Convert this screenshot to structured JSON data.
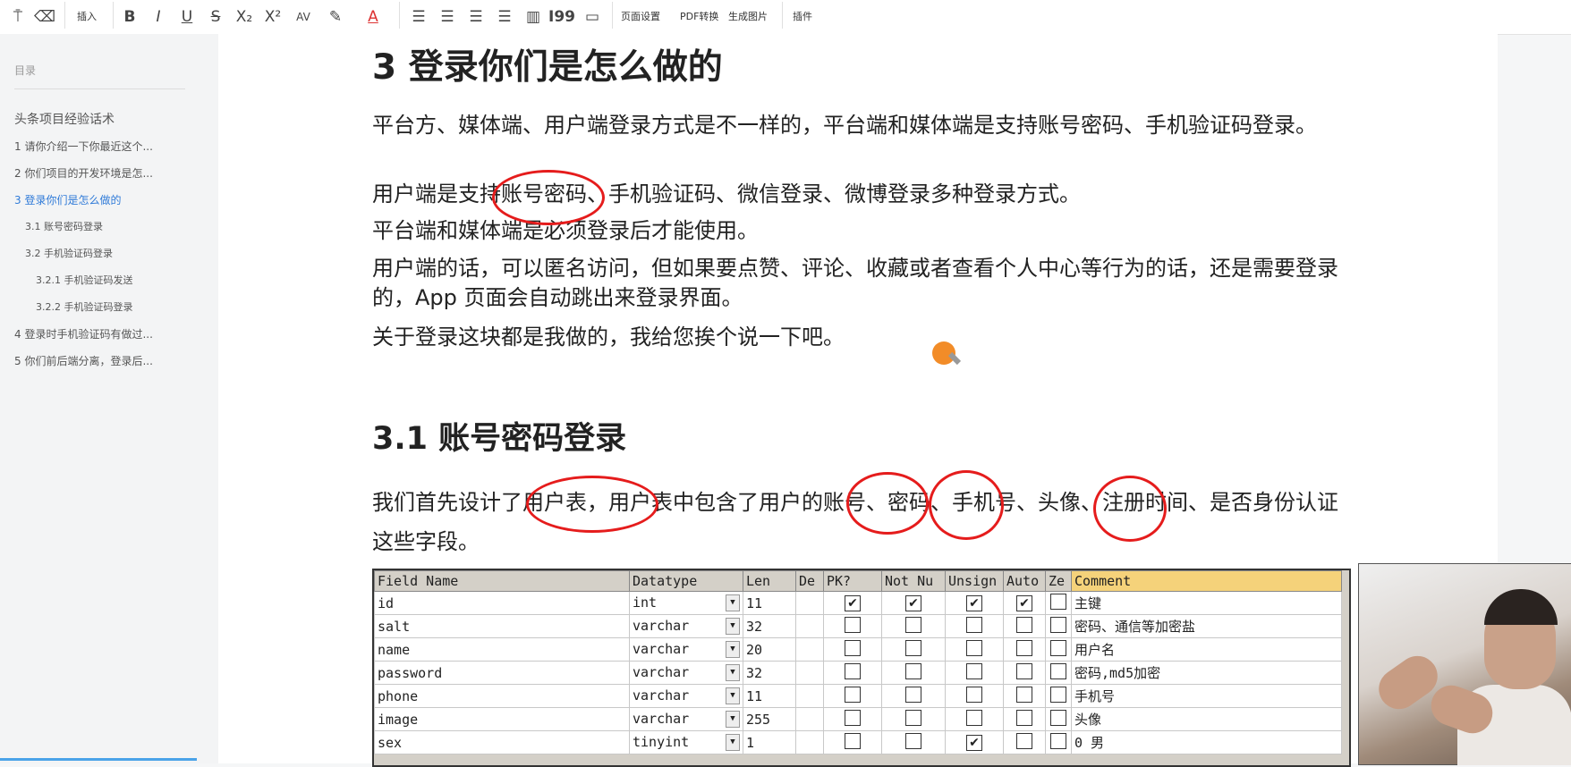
{
  "toolbar": {
    "insert": "插入",
    "page_setup": "页面设置",
    "pdf_convert": "PDF转换",
    "gen_image": "生成图片",
    "plugin": "插件"
  },
  "sidebar": {
    "title": "目录",
    "items": [
      "头条项目经验话术",
      "1 请你介绍一下你最近这个...",
      "2 你们项目的开发环境是怎...",
      "3 登录你们是怎么做的",
      "3.1 账号密码登录",
      "3.2 手机验证码登录",
      "3.2.1 手机验证码发送",
      "3.2.2 手机验证码登录",
      "4 登录时手机验证码有做过...",
      "5 你们前后端分离，登录后..."
    ]
  },
  "doc": {
    "h1": "3 登录你们是怎么做的",
    "p1": "平台方、媒体端、用户端登录方式是不一样的，平台端和媒体端是支持账号密码、手机验证码登录。",
    "p2": "用户端是支持账号密码、手机验证码、微信登录、微博登录多种登录方式。",
    "p3": "平台端和媒体端是必须登录后才能使用。",
    "p4": "用户端的话，可以匿名访问，但如果要点赞、评论、收藏或者查看个人中心等行为的话，还是需要登录的，App 页面会自动跳出来登录界面。",
    "p5": "关于登录这块都是我做的，我给您挨个说一下吧。",
    "h2": "3.1 账号密码登录",
    "p6": "我们首先设计了用户表，用户表中包含了用户的账号、密码、手机号、头像、注册时间、是否身份认证这些字段。"
  },
  "table": {
    "headers": [
      "Field Name",
      "Datatype",
      "Len",
      "De",
      "PK?",
      "Not Nu",
      "Unsign",
      "Auto",
      "Ze",
      "Comment"
    ],
    "rows": [
      {
        "field": "id",
        "type": "int",
        "len": "11",
        "pk": true,
        "nn": true,
        "un": true,
        "auto": true,
        "ze": false,
        "comment": "主键"
      },
      {
        "field": "salt",
        "type": "varchar",
        "len": "32",
        "pk": false,
        "nn": false,
        "un": false,
        "auto": false,
        "ze": false,
        "comment": "密码、通信等加密盐"
      },
      {
        "field": "name",
        "type": "varchar",
        "len": "20",
        "pk": false,
        "nn": false,
        "un": false,
        "auto": false,
        "ze": false,
        "comment": "用户名"
      },
      {
        "field": "password",
        "type": "varchar",
        "len": "32",
        "pk": false,
        "nn": false,
        "un": false,
        "auto": false,
        "ze": false,
        "comment": "密码,md5加密"
      },
      {
        "field": "phone",
        "type": "varchar",
        "len": "11",
        "pk": false,
        "nn": false,
        "un": false,
        "auto": false,
        "ze": false,
        "comment": "手机号"
      },
      {
        "field": "image",
        "type": "varchar",
        "len": "255",
        "pk": false,
        "nn": false,
        "un": false,
        "auto": false,
        "ze": false,
        "comment": "头像"
      },
      {
        "field": "sex",
        "type": "tinyint",
        "len": "1",
        "pk": false,
        "nn": false,
        "un": true,
        "auto": false,
        "ze": false,
        "comment": "0 男"
      }
    ]
  },
  "colors": {
    "accent": "#2f7ad8",
    "annotation": "#e51c1c",
    "cursor": "#f28c28"
  }
}
